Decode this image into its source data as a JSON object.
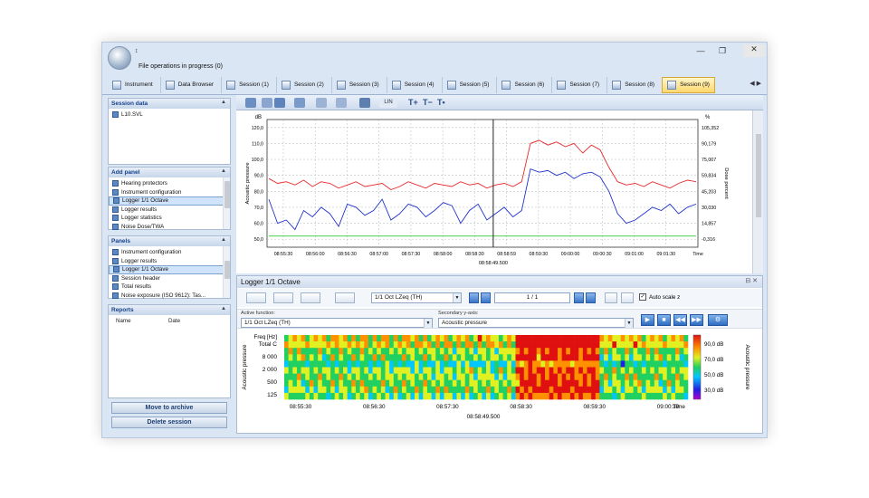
{
  "window": {
    "status": "File operations in progress (0)",
    "qat_glyph": "↕"
  },
  "tabs": [
    {
      "label": "Instrument",
      "active": false
    },
    {
      "label": "Data Browser",
      "active": false
    },
    {
      "label": "Session (1)",
      "active": false
    },
    {
      "label": "Session (2)",
      "active": false
    },
    {
      "label": "Session (3)",
      "active": false
    },
    {
      "label": "Session (4)",
      "active": false
    },
    {
      "label": "Session (5)",
      "active": false
    },
    {
      "label": "Session (6)",
      "active": false
    },
    {
      "label": "Session (7)",
      "active": false
    },
    {
      "label": "Session (8)",
      "active": false
    },
    {
      "label": "Session (9)",
      "active": true
    }
  ],
  "session_data": {
    "title": "Session data",
    "items": [
      "L10.SVL"
    ]
  },
  "add_panel": {
    "title": "Add panel",
    "items": [
      "Hearing protectors",
      "Instrument configuration",
      "Logger 1/1 Octave",
      "Logger results",
      "Logger statistics",
      "Noise Dose/TWA"
    ],
    "selected": 2
  },
  "panels": {
    "title": "Panels",
    "items": [
      "Instrument configuration",
      "Logger results",
      "Logger 1/1 Octave",
      "Session header",
      "Total results",
      "Noise exposure (ISO 9612): Tas..."
    ],
    "selected": 2
  },
  "reports": {
    "title": "Reports",
    "columns": [
      "Name",
      "Date"
    ]
  },
  "buttons": {
    "archive": "Move to archive",
    "delete": "Delete session"
  },
  "toolbar": {
    "lin_label": "LIN",
    "text_tools": [
      "T+",
      "T−",
      "T•"
    ]
  },
  "logger_panel": {
    "title": "Logger 1/1 Octave",
    "function_combo": "1/1 Oct LZeq (TH)",
    "page": "1 / 1",
    "auto_scale": "Auto scale z",
    "active_function_label": "Active function:",
    "active_function_value": "1/1 Oct LZeq (TH)",
    "secondary_label": "Secondary y-axis:",
    "secondary_value": "Acoustic pressure"
  },
  "chart_data": [
    {
      "type": "line",
      "y_unit": "dB",
      "y2_unit": "%",
      "ylabel": "Acoustic pressure",
      "y2label": "Dose percent",
      "yticks": [
        "50,0",
        "60,0",
        "70,0",
        "80,0",
        "90,0",
        "100,0",
        "110,0",
        "120,0"
      ],
      "y2ticks": [
        "-0,316",
        "14,857",
        "30,030",
        "45,203",
        "59,834",
        "75,007",
        "90,179",
        "105,352"
      ],
      "xticks": [
        "08:55:30",
        "08:56:00",
        "08:56:30",
        "08:57:00",
        "08:57:30",
        "08:58:00",
        "08:58:30",
        "08:58:59",
        "08:59:30",
        "09:00:00",
        "09:00:30",
        "09:01:00",
        "09:01:30",
        "Time"
      ],
      "cursor_label": "08:58:49.500",
      "ylim": [
        45,
        125
      ],
      "grid": true,
      "series": [
        {
          "color": "#e8292b",
          "values": [
            88,
            85,
            86,
            84,
            87,
            83,
            86,
            85,
            82,
            84,
            86,
            83,
            84,
            85,
            81,
            83,
            86,
            84,
            82,
            85,
            84,
            83,
            86,
            84,
            85,
            82,
            84,
            85,
            83,
            86,
            110,
            112,
            109,
            111,
            108,
            110,
            104,
            109,
            106,
            95,
            86,
            84,
            85,
            83,
            86,
            84,
            82,
            85,
            87,
            86
          ]
        },
        {
          "color": "#2233cc",
          "values": [
            75,
            60,
            62,
            56,
            68,
            64,
            70,
            66,
            58,
            72,
            70,
            65,
            68,
            75,
            62,
            66,
            72,
            70,
            64,
            68,
            73,
            71,
            60,
            68,
            72,
            62,
            66,
            70,
            64,
            68,
            94,
            92,
            93,
            90,
            92,
            88,
            91,
            92,
            89,
            80,
            66,
            60,
            62,
            66,
            70,
            68,
            72,
            66,
            70,
            72
          ]
        },
        {
          "color": "#33cc33",
          "values": [
            52,
            52,
            52,
            52,
            52,
            52,
            52,
            52,
            52,
            52,
            52,
            52,
            52,
            52,
            52,
            52,
            52,
            52,
            52,
            52,
            52,
            52,
            52,
            52,
            52,
            52,
            52,
            52,
            52,
            52,
            52,
            52,
            52,
            52,
            52,
            52,
            52,
            52,
            52,
            52,
            52,
            52,
            52,
            52,
            52,
            52,
            52,
            52,
            52,
            52
          ]
        }
      ]
    },
    {
      "type": "heatmap",
      "ylabel": "Freq [Hz]",
      "yticks": [
        "Total C",
        "8 000",
        "2 000",
        "500",
        "125"
      ],
      "xticks": [
        "08:55:30",
        "08:56:30",
        "08:57:30",
        "08:58:30",
        "08:59:30",
        "09:00:30",
        "Time"
      ],
      "cursor_label": "08:58:49.500",
      "colorbar_ticks": [
        "90,0 dB",
        "70,0 dB",
        "50,0 dB",
        "30,0 dB"
      ],
      "colorbar_label": "Acoustic pressure",
      "zlim": [
        25,
        95
      ]
    }
  ]
}
